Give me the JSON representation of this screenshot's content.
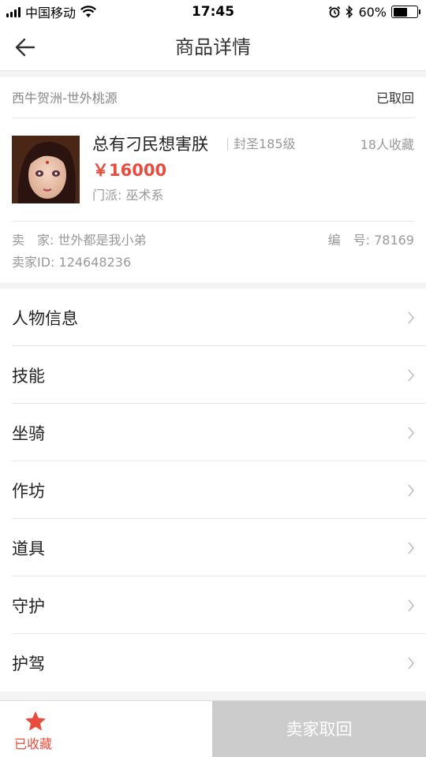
{
  "status_bar": {
    "carrier": "中国移动",
    "time": "17:45",
    "battery": "60%",
    "battery_level": 0.6,
    "icons": [
      "signal-icon",
      "wifi-icon",
      "alarm-icon",
      "bluetooth-icon",
      "battery-icon"
    ]
  },
  "nav": {
    "title": "商品详情",
    "back_icon": "back-arrow-icon"
  },
  "product": {
    "server": "西牛贺洲-世外桃源",
    "status": "已取回",
    "name": "总有刁民想害朕",
    "level": "封圣185级",
    "favorites": "18人收藏",
    "price": "￥16000",
    "school": "门派: 巫术系",
    "seller": "卖　家: 世外都是我小弟",
    "serial": "编　号: 78169",
    "seller_id": "卖家ID: 124648236"
  },
  "menu": [
    {
      "label": "人物信息"
    },
    {
      "label": "技能"
    },
    {
      "label": "坐骑"
    },
    {
      "label": "作坊"
    },
    {
      "label": "道具"
    },
    {
      "label": "守护"
    },
    {
      "label": "护驾"
    }
  ],
  "bottom": {
    "favorite_label": "已收藏",
    "retract_label": "卖家取回"
  },
  "colors": {
    "accent": "#e84c3d",
    "disabled": "#cccccc",
    "muted_text": "#999999"
  }
}
